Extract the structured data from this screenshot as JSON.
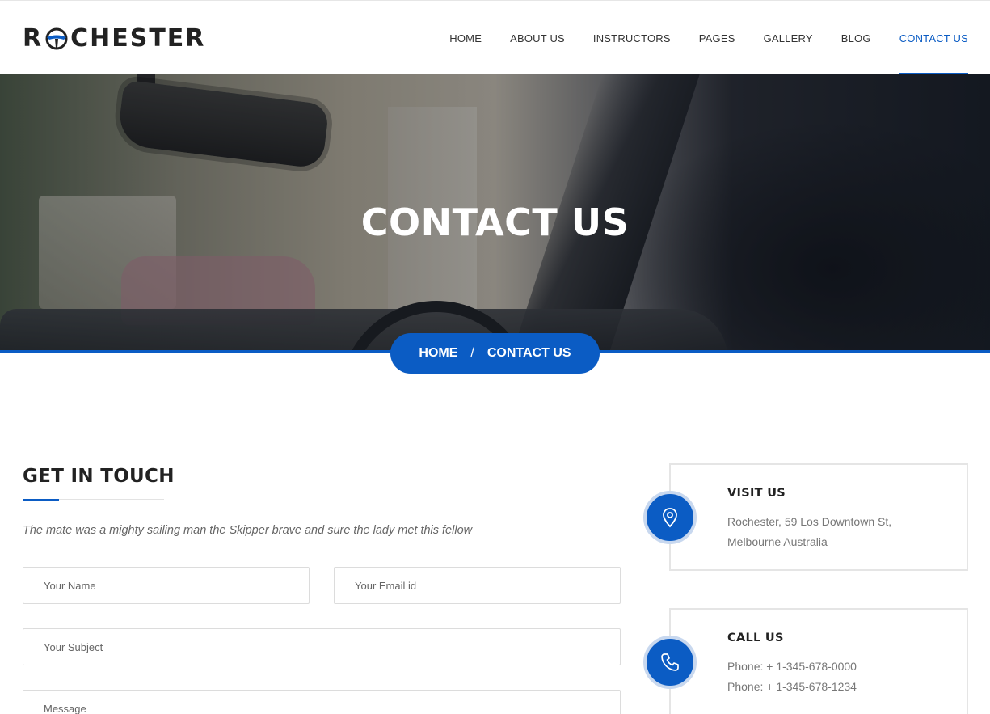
{
  "brand": {
    "logo_left": "R",
    "logo_right": "CHESTER"
  },
  "nav": {
    "items": [
      {
        "label": "HOME"
      },
      {
        "label": "ABOUT US"
      },
      {
        "label": "INSTRUCTORS"
      },
      {
        "label": "PAGES"
      },
      {
        "label": "GALLERY"
      },
      {
        "label": "BLOG"
      },
      {
        "label": "CONTACT US"
      }
    ],
    "active": "CONTACT US"
  },
  "hero": {
    "title": "CONTACT US",
    "breadcrumb": {
      "home": "HOME",
      "separator": "/",
      "current": "CONTACT US"
    }
  },
  "contact_form": {
    "title": "GET IN TOUCH",
    "subtitle": "The mate was a mighty sailing man the Skipper brave and sure the lady met this fellow",
    "name_placeholder": "Your Name",
    "email_placeholder": "Your Email id",
    "subject_placeholder": "Your Subject",
    "message_placeholder": "Message"
  },
  "info": {
    "visit": {
      "title": "VISIT US",
      "line1": "Rochester, 59 Los Downtown St,",
      "line2": "Melbourne Australia",
      "icon": "map-pin-icon"
    },
    "call": {
      "title": "CALL US",
      "line1": "Phone: + 1-345-678-0000",
      "line2": "Phone: + 1-345-678-1234",
      "icon": "phone-icon"
    }
  },
  "colors": {
    "accent": "#0b5cc4",
    "text_dark": "#222222",
    "text_muted": "#777777"
  }
}
